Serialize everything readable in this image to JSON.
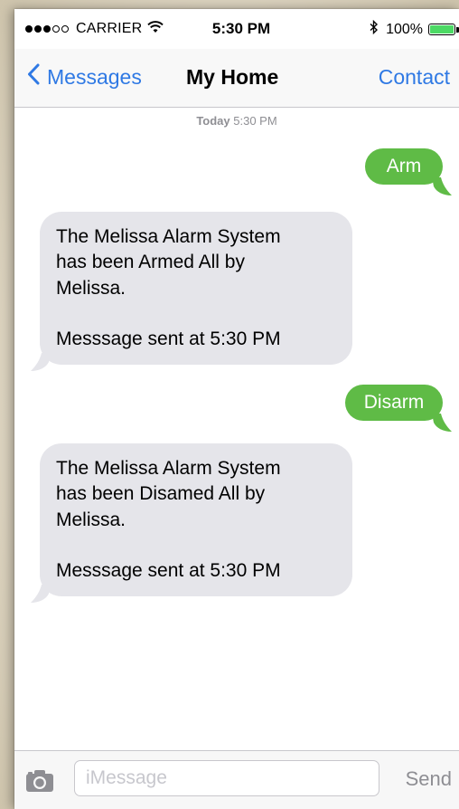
{
  "status_bar": {
    "carrier": "CARRIER",
    "time": "5:30 PM",
    "battery_percent": "100%",
    "signal_icon": "signal-dots-icon",
    "wifi_icon": "wifi-icon",
    "bluetooth_icon": "bluetooth-icon",
    "battery_icon": "battery-icon",
    "battery_level": 1.0
  },
  "nav": {
    "back_label": "Messages",
    "title": "My Home",
    "contact_label": "Contact"
  },
  "thread": {
    "timestamp_day": "Today",
    "timestamp_time": "5:30 PM",
    "messages": [
      {
        "direction": "outgoing",
        "text": "Arm"
      },
      {
        "direction": "incoming",
        "lines": [
          "The Melissa Alarm System",
          "has been Armed All by",
          "Melissa."
        ],
        "footer": "Messsage sent at 5:30 PM"
      },
      {
        "direction": "outgoing",
        "text": "Disarm"
      },
      {
        "direction": "incoming",
        "lines": [
          "The Melissa Alarm System",
          "has been Disamed All by",
          "Melissa."
        ],
        "footer": "Messsage sent at 5:30 PM"
      }
    ]
  },
  "composer": {
    "placeholder": "iMessage",
    "send_label": "Send",
    "camera_icon": "camera-icon"
  },
  "colors": {
    "accent": "#2f79e4",
    "outgoing_bubble": "#5fbb46",
    "incoming_bubble": "#e5e5ea",
    "battery": "#4cd964"
  }
}
